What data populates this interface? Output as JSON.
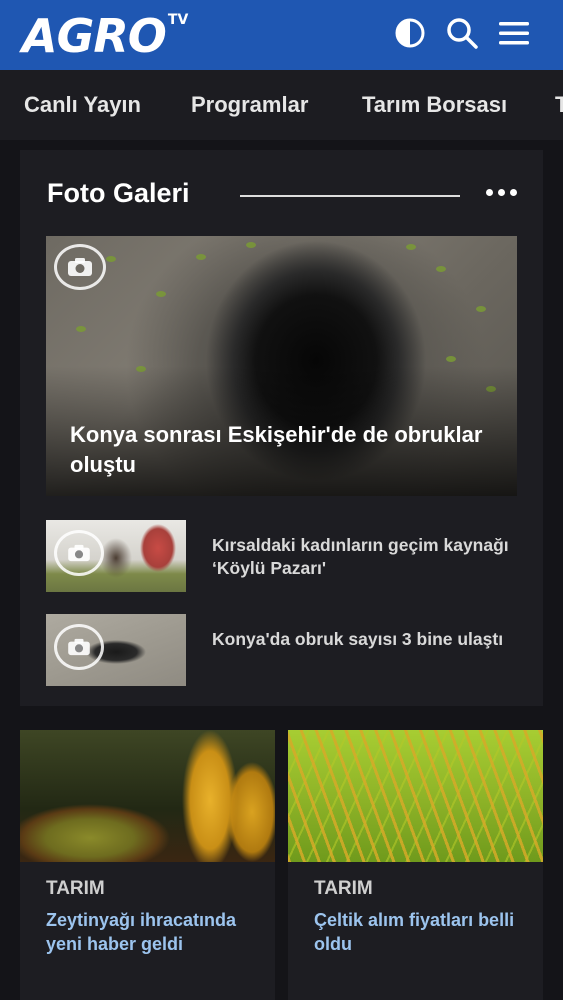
{
  "header": {
    "logo_text": "AGRO",
    "logo_sub": "TV",
    "bg_color": "#1f57b2"
  },
  "icons": {
    "theme": "contrast-icon",
    "search": "search-icon",
    "menu": "hamburger-menu-icon"
  },
  "nav": {
    "items": [
      "Canlı Yayın",
      "Programlar",
      "Tarım Borsası",
      "T"
    ]
  },
  "gallery": {
    "title": "Foto Galeri",
    "hero": {
      "title": "Konya sonrası Eskişehir'de de obruklar oluştu"
    },
    "items": [
      {
        "title": "Kırsaldaki kadınların geçim kaynağı ‘Köylü Pazarı'"
      },
      {
        "title": "Konya'da obruk sayısı 3 bine ulaştı"
      }
    ]
  },
  "cards": [
    {
      "category": "TARIM",
      "title": "Zeytinyağı ihracatında yeni haber geldi"
    },
    {
      "category": "TARIM",
      "title": "Çeltik alım fiyatları belli oldu"
    }
  ],
  "colors": {
    "background": "#141418",
    "card_title": "#9cc4ee"
  }
}
